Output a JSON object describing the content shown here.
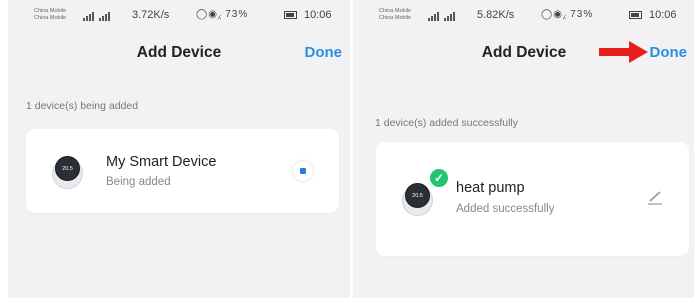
{
  "left_screen": {
    "status_bar": {
      "carrier_lines": [
        "China Mobile",
        "China Mobile"
      ],
      "speed": "3.72K/s",
      "battery": "73%",
      "time": "10:06"
    },
    "header": {
      "title": "Add Device",
      "done_label": "Done"
    },
    "section_label": "1 device(s) being added",
    "device": {
      "thumbnail_text": "20.5",
      "name": "My Smart Device",
      "status": "Being added",
      "status_icon": "loading-spinner-icon",
      "accent": "#2b7fd9"
    }
  },
  "right_screen": {
    "status_bar": {
      "carrier_lines": [
        "China Mobile",
        "China Mobile"
      ],
      "speed": "5.82K/s",
      "battery": "73%",
      "time": "10:06"
    },
    "header": {
      "title": "Add Device",
      "done_label": "Done"
    },
    "section_label": "1 device(s) added successfully",
    "device": {
      "thumbnail_text": "20.5",
      "name": "heat pump",
      "status": "Added successfully",
      "badge_icon": "checkmark-icon",
      "badge_color": "#22c46f",
      "action_icon": "edit-pencil-icon"
    },
    "annotation": {
      "icon": "red-arrow-icon",
      "color": "#e8201c"
    }
  },
  "colors": {
    "done": "#2b8fe0",
    "background": "#f2f2f4",
    "card": "#ffffff"
  }
}
